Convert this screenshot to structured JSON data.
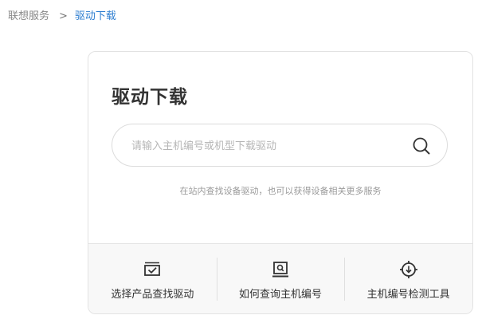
{
  "breadcrumb": {
    "home": "联想服务",
    "separator": ">",
    "current": "驱动下载"
  },
  "card": {
    "title": "驱动下载",
    "search": {
      "placeholder": "请输入主机编号或机型下载驱动",
      "value": "",
      "icon": "search-icon"
    },
    "hint": "在站内查找设备驱动，也可以获得设备相关更多服务"
  },
  "tools": [
    {
      "label": "选择产品查找驱动",
      "icon": "monitor-check-icon"
    },
    {
      "label": "如何查询主机编号",
      "icon": "laptop-search-icon"
    },
    {
      "label": "主机编号检测工具",
      "icon": "crosshair-download-icon"
    }
  ],
  "colors": {
    "accent": "#2f7fd1",
    "text": "#333333",
    "muted": "#9a9a9a",
    "tools_bg": "#f8f8f8"
  }
}
